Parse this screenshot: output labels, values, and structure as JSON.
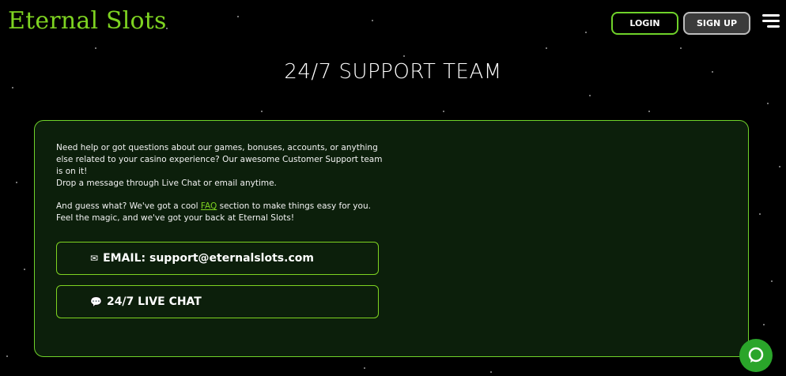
{
  "header": {
    "logo": "Eternal Slots",
    "login_label": "LOGIN",
    "signup_label": "SIGN UP",
    "menu_icon": "hamburger-menu-icon"
  },
  "page": {
    "title": "24/7 SUPPORT TEAM"
  },
  "support": {
    "intro": "Need help or got questions about our games, bonuses, accounts, or anything else related to your casino experience? Our awesome Customer Support team is on it!",
    "drop_message": "Drop a message through Live Chat or email anytime.",
    "faq_before": "And guess what? We've got a cool ",
    "faq_link": "FAQ",
    "faq_after": " section to make things easy for you. Feel the magic, and we've got your back at Eternal Slots!",
    "email_icon": "✉",
    "email_label": "EMAIL: support@eternalslots.com",
    "chat_icon": "💬",
    "chat_label": "24/7 LIVE CHAT"
  },
  "colors": {
    "accent": "#7ed321",
    "card_bg": "#0c1f0b",
    "chat_widget": "#2aa52a"
  },
  "widget": {
    "chat_icon": "chat-bubble-icon"
  }
}
